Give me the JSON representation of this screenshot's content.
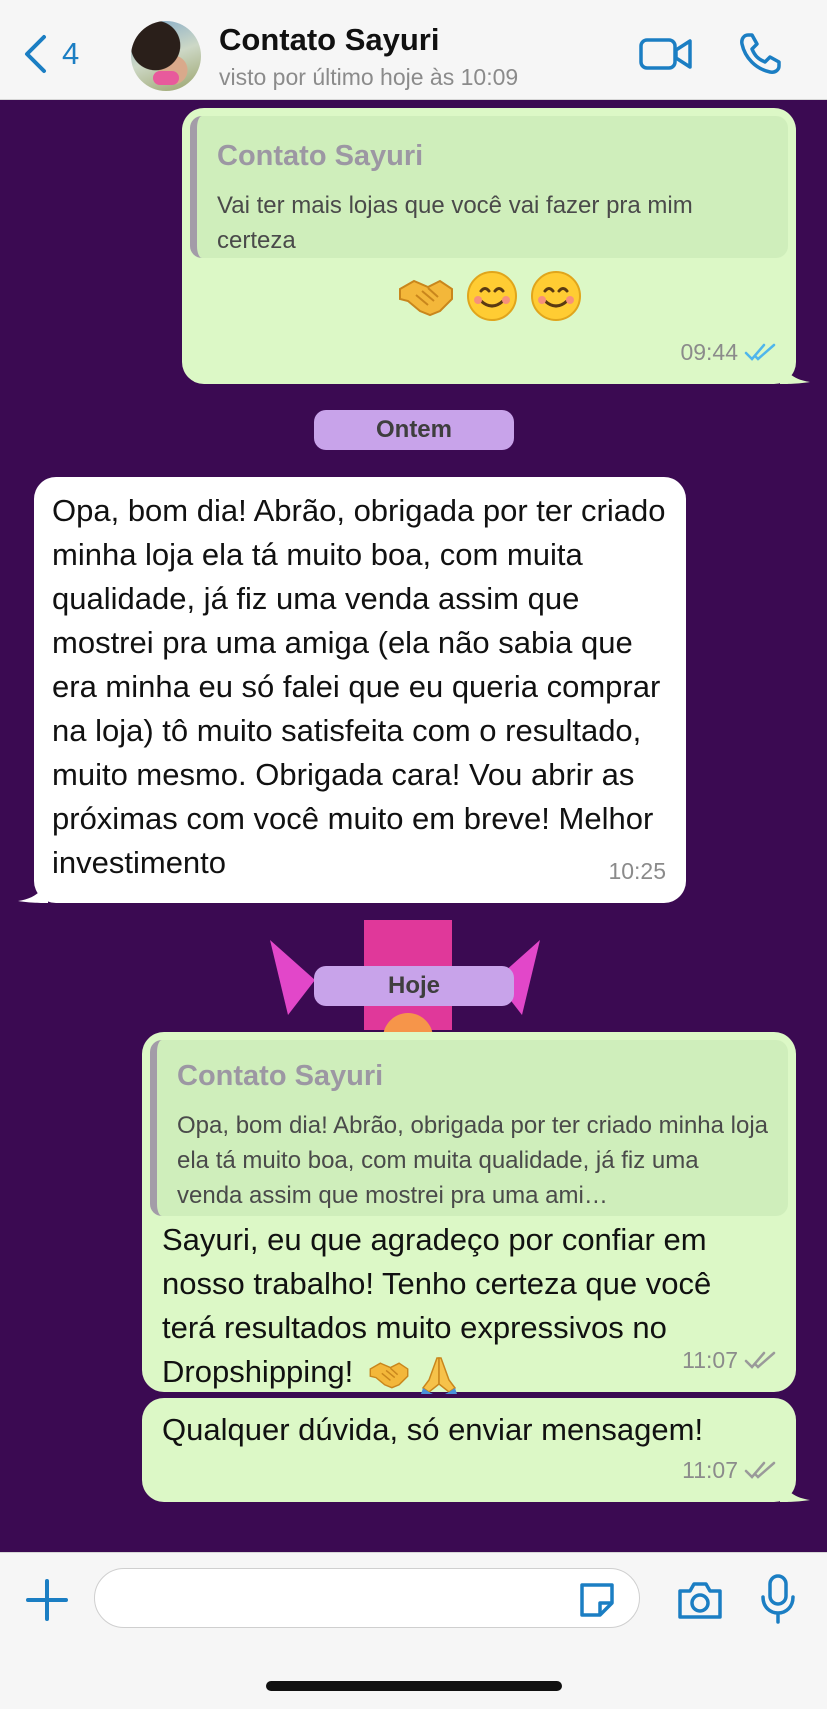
{
  "header": {
    "back_count": "4",
    "contact_name": "Contato Sayuri",
    "last_seen": "visto por último hoje às 10:09"
  },
  "messages": {
    "m1": {
      "quote_name": "Contato Sayuri",
      "quote_text": "Vai ter mais lojas que você vai fazer pra mim certeza",
      "emojis": [
        "handshake",
        "smiling-face",
        "smiling-face"
      ],
      "time": "09:44",
      "status": "read"
    },
    "date1": "Ontem",
    "m2": {
      "text": "Opa, bom dia! Abrão, obrigada por ter criado minha loja ela tá muito boa, com muita qualidade, já fiz uma venda assim que mostrei pra uma amiga (ela não sabia que era minha eu só falei que eu queria comprar na loja) tô muito satisfeita com o resultado, muito mesmo. Obrigada cara! Vou abrir as próximas com você muito em breve! Melhor investimento",
      "time": "10:25"
    },
    "date2": "Hoje",
    "m3": {
      "quote_name": "Contato Sayuri",
      "quote_text": "Opa, bom dia! Abrão, obrigada por ter criado minha loja ela tá muito boa, com muita qualidade, já fiz uma venda assim que mostrei pra uma ami…",
      "text": "Sayuri, eu que agradeço por confiar em nosso trabalho! Tenho certeza que você terá resultados muito expressivos no Dropshipping!",
      "emojis": [
        "handshake",
        "folded-hands"
      ],
      "time": "11:07",
      "status": "delivered"
    },
    "m4": {
      "text": "Qualquer dúvida, só enviar mensagem!",
      "time": "11:07",
      "status": "delivered"
    }
  },
  "composer": {
    "value": "",
    "icons": [
      "plus-icon",
      "sticker-icon",
      "camera-icon",
      "microphone-icon"
    ]
  },
  "colors": {
    "accent": "#1b7ec3",
    "chat_bg": "#3b0a52",
    "outgoing": "#dcf8c6",
    "incoming": "#ffffff",
    "read_ticks": "#4fb6ec",
    "date_pill": "#c8a3ea"
  }
}
